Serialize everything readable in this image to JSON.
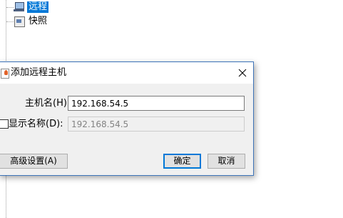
{
  "tree": {
    "items": [
      {
        "label": "远程",
        "icon": "remote-computer-icon",
        "selected": true
      },
      {
        "label": "快照",
        "icon": "snapshot-icon",
        "selected": false
      }
    ]
  },
  "dialog": {
    "title": "添加远程主机",
    "host_label": "主机名(H):",
    "host_value": "192.168.54.5",
    "display_label": "显示名称(D):",
    "display_value": "192.168.54.5",
    "display_checked": false,
    "advanced_label": "高级设置(A)",
    "ok_label": "确定",
    "cancel_label": "取消"
  },
  "colors": {
    "selection": "#0078d7",
    "dialog_border": "#3d74b9",
    "dialog_background": "#f0f0f0"
  }
}
